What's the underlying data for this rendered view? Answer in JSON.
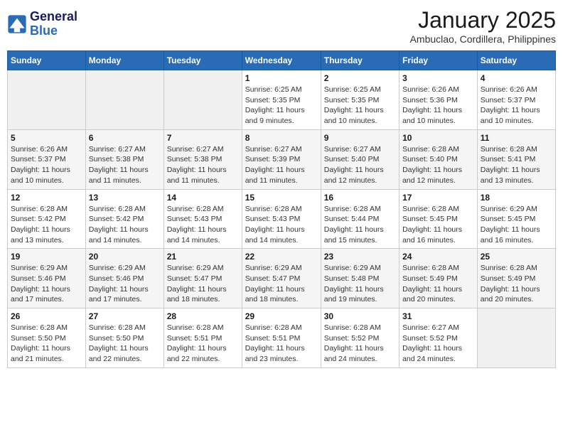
{
  "logo": {
    "line1": "General",
    "line2": "Blue"
  },
  "title": "January 2025",
  "subtitle": "Ambuclao, Cordillera, Philippines",
  "weekdays": [
    "Sunday",
    "Monday",
    "Tuesday",
    "Wednesday",
    "Thursday",
    "Friday",
    "Saturday"
  ],
  "weeks": [
    [
      {
        "day": "",
        "sunrise": "",
        "sunset": "",
        "daylight": ""
      },
      {
        "day": "",
        "sunrise": "",
        "sunset": "",
        "daylight": ""
      },
      {
        "day": "",
        "sunrise": "",
        "sunset": "",
        "daylight": ""
      },
      {
        "day": "1",
        "sunrise": "Sunrise: 6:25 AM",
        "sunset": "Sunset: 5:35 PM",
        "daylight": "Daylight: 11 hours and 9 minutes."
      },
      {
        "day": "2",
        "sunrise": "Sunrise: 6:25 AM",
        "sunset": "Sunset: 5:35 PM",
        "daylight": "Daylight: 11 hours and 10 minutes."
      },
      {
        "day": "3",
        "sunrise": "Sunrise: 6:26 AM",
        "sunset": "Sunset: 5:36 PM",
        "daylight": "Daylight: 11 hours and 10 minutes."
      },
      {
        "day": "4",
        "sunrise": "Sunrise: 6:26 AM",
        "sunset": "Sunset: 5:37 PM",
        "daylight": "Daylight: 11 hours and 10 minutes."
      }
    ],
    [
      {
        "day": "5",
        "sunrise": "Sunrise: 6:26 AM",
        "sunset": "Sunset: 5:37 PM",
        "daylight": "Daylight: 11 hours and 10 minutes."
      },
      {
        "day": "6",
        "sunrise": "Sunrise: 6:27 AM",
        "sunset": "Sunset: 5:38 PM",
        "daylight": "Daylight: 11 hours and 11 minutes."
      },
      {
        "day": "7",
        "sunrise": "Sunrise: 6:27 AM",
        "sunset": "Sunset: 5:38 PM",
        "daylight": "Daylight: 11 hours and 11 minutes."
      },
      {
        "day": "8",
        "sunrise": "Sunrise: 6:27 AM",
        "sunset": "Sunset: 5:39 PM",
        "daylight": "Daylight: 11 hours and 11 minutes."
      },
      {
        "day": "9",
        "sunrise": "Sunrise: 6:27 AM",
        "sunset": "Sunset: 5:40 PM",
        "daylight": "Daylight: 11 hours and 12 minutes."
      },
      {
        "day": "10",
        "sunrise": "Sunrise: 6:28 AM",
        "sunset": "Sunset: 5:40 PM",
        "daylight": "Daylight: 11 hours and 12 minutes."
      },
      {
        "day": "11",
        "sunrise": "Sunrise: 6:28 AM",
        "sunset": "Sunset: 5:41 PM",
        "daylight": "Daylight: 11 hours and 13 minutes."
      }
    ],
    [
      {
        "day": "12",
        "sunrise": "Sunrise: 6:28 AM",
        "sunset": "Sunset: 5:42 PM",
        "daylight": "Daylight: 11 hours and 13 minutes."
      },
      {
        "day": "13",
        "sunrise": "Sunrise: 6:28 AM",
        "sunset": "Sunset: 5:42 PM",
        "daylight": "Daylight: 11 hours and 14 minutes."
      },
      {
        "day": "14",
        "sunrise": "Sunrise: 6:28 AM",
        "sunset": "Sunset: 5:43 PM",
        "daylight": "Daylight: 11 hours and 14 minutes."
      },
      {
        "day": "15",
        "sunrise": "Sunrise: 6:28 AM",
        "sunset": "Sunset: 5:43 PM",
        "daylight": "Daylight: 11 hours and 14 minutes."
      },
      {
        "day": "16",
        "sunrise": "Sunrise: 6:28 AM",
        "sunset": "Sunset: 5:44 PM",
        "daylight": "Daylight: 11 hours and 15 minutes."
      },
      {
        "day": "17",
        "sunrise": "Sunrise: 6:28 AM",
        "sunset": "Sunset: 5:45 PM",
        "daylight": "Daylight: 11 hours and 16 minutes."
      },
      {
        "day": "18",
        "sunrise": "Sunrise: 6:29 AM",
        "sunset": "Sunset: 5:45 PM",
        "daylight": "Daylight: 11 hours and 16 minutes."
      }
    ],
    [
      {
        "day": "19",
        "sunrise": "Sunrise: 6:29 AM",
        "sunset": "Sunset: 5:46 PM",
        "daylight": "Daylight: 11 hours and 17 minutes."
      },
      {
        "day": "20",
        "sunrise": "Sunrise: 6:29 AM",
        "sunset": "Sunset: 5:46 PM",
        "daylight": "Daylight: 11 hours and 17 minutes."
      },
      {
        "day": "21",
        "sunrise": "Sunrise: 6:29 AM",
        "sunset": "Sunset: 5:47 PM",
        "daylight": "Daylight: 11 hours and 18 minutes."
      },
      {
        "day": "22",
        "sunrise": "Sunrise: 6:29 AM",
        "sunset": "Sunset: 5:47 PM",
        "daylight": "Daylight: 11 hours and 18 minutes."
      },
      {
        "day": "23",
        "sunrise": "Sunrise: 6:29 AM",
        "sunset": "Sunset: 5:48 PM",
        "daylight": "Daylight: 11 hours and 19 minutes."
      },
      {
        "day": "24",
        "sunrise": "Sunrise: 6:28 AM",
        "sunset": "Sunset: 5:49 PM",
        "daylight": "Daylight: 11 hours and 20 minutes."
      },
      {
        "day": "25",
        "sunrise": "Sunrise: 6:28 AM",
        "sunset": "Sunset: 5:49 PM",
        "daylight": "Daylight: 11 hours and 20 minutes."
      }
    ],
    [
      {
        "day": "26",
        "sunrise": "Sunrise: 6:28 AM",
        "sunset": "Sunset: 5:50 PM",
        "daylight": "Daylight: 11 hours and 21 minutes."
      },
      {
        "day": "27",
        "sunrise": "Sunrise: 6:28 AM",
        "sunset": "Sunset: 5:50 PM",
        "daylight": "Daylight: 11 hours and 22 minutes."
      },
      {
        "day": "28",
        "sunrise": "Sunrise: 6:28 AM",
        "sunset": "Sunset: 5:51 PM",
        "daylight": "Daylight: 11 hours and 22 minutes."
      },
      {
        "day": "29",
        "sunrise": "Sunrise: 6:28 AM",
        "sunset": "Sunset: 5:51 PM",
        "daylight": "Daylight: 11 hours and 23 minutes."
      },
      {
        "day": "30",
        "sunrise": "Sunrise: 6:28 AM",
        "sunset": "Sunset: 5:52 PM",
        "daylight": "Daylight: 11 hours and 24 minutes."
      },
      {
        "day": "31",
        "sunrise": "Sunrise: 6:27 AM",
        "sunset": "Sunset: 5:52 PM",
        "daylight": "Daylight: 11 hours and 24 minutes."
      },
      {
        "day": "",
        "sunrise": "",
        "sunset": "",
        "daylight": ""
      }
    ]
  ]
}
